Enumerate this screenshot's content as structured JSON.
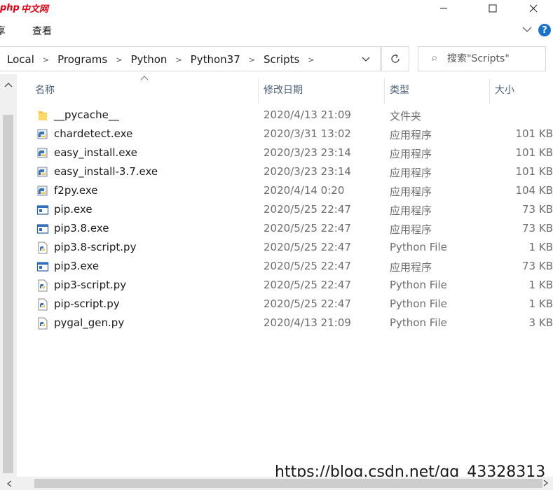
{
  "titlebar": {
    "logo_php": "php",
    "logo_cn": "中文网"
  },
  "ribbon": {
    "tabs": [
      "享",
      "查看"
    ]
  },
  "address": {
    "crumbs": [
      "Local",
      "Programs",
      "Python",
      "Python37",
      "Scripts"
    ]
  },
  "search": {
    "placeholder": "搜索\"Scripts\""
  },
  "columns": {
    "name": "名称",
    "date": "修改日期",
    "type": "类型",
    "size": "大小"
  },
  "files": [
    {
      "name": "__pycache__",
      "date": "2020/4/13 21:09",
      "type": "文件夹",
      "size": "",
      "icon": "folder-icon"
    },
    {
      "name": "chardetect.exe",
      "date": "2020/3/31 13:02",
      "type": "应用程序",
      "size": "101 KB",
      "icon": "python-exe-icon"
    },
    {
      "name": "easy_install.exe",
      "date": "2020/3/23 23:14",
      "type": "应用程序",
      "size": "101 KB",
      "icon": "python-exe-icon"
    },
    {
      "name": "easy_install-3.7.exe",
      "date": "2020/3/23 23:14",
      "type": "应用程序",
      "size": "101 KB",
      "icon": "python-exe-icon"
    },
    {
      "name": "f2py.exe",
      "date": "2020/4/14 0:20",
      "type": "应用程序",
      "size": "104 KB",
      "icon": "python-exe-icon"
    },
    {
      "name": "pip.exe",
      "date": "2020/5/25 22:47",
      "type": "应用程序",
      "size": "73 KB",
      "icon": "window-exe-icon"
    },
    {
      "name": "pip3.8.exe",
      "date": "2020/5/25 22:47",
      "type": "应用程序",
      "size": "73 KB",
      "icon": "window-exe-icon"
    },
    {
      "name": "pip3.8-script.py",
      "date": "2020/5/25 22:47",
      "type": "Python File",
      "size": "1 KB",
      "icon": "python-file-icon"
    },
    {
      "name": "pip3.exe",
      "date": "2020/5/25 22:47",
      "type": "应用程序",
      "size": "73 KB",
      "icon": "window-exe-icon"
    },
    {
      "name": "pip3-script.py",
      "date": "2020/5/25 22:47",
      "type": "Python File",
      "size": "1 KB",
      "icon": "python-file-icon"
    },
    {
      "name": "pip-script.py",
      "date": "2020/5/25 22:47",
      "type": "Python File",
      "size": "1 KB",
      "icon": "python-file-icon"
    },
    {
      "name": "pygal_gen.py",
      "date": "2020/4/13 21:09",
      "type": "Python File",
      "size": "3 KB",
      "icon": "python-file-icon"
    }
  ],
  "help": {
    "label": "?"
  },
  "watermark": "https://blog.csdn.net/qq_43328313"
}
